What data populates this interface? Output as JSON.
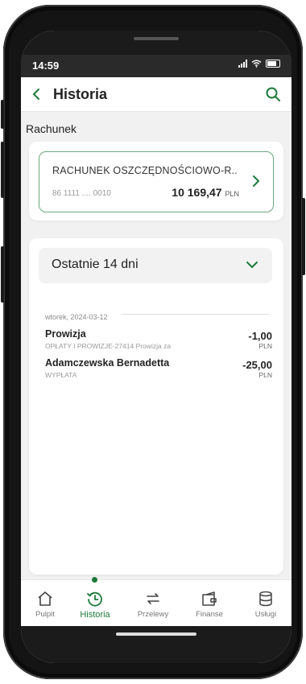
{
  "status": {
    "time": "14:59"
  },
  "header": {
    "title": "Historia"
  },
  "section": {
    "label": "Rachunek"
  },
  "account": {
    "name": "RACHUNEK OSZCZĘDNOŚCIOWO-R..",
    "number": "86 1111 .... 0010",
    "balance": "10 169,47",
    "currency": "PLN"
  },
  "filter": {
    "label": "Ostatnie 14 dni"
  },
  "transactions": {
    "date": "wtorek, 2024-03-12",
    "items": [
      {
        "title": "Prowizja",
        "subtitle": "OPŁATY I PROWIZJE-27414 Prowizja za",
        "amount": "-1,00",
        "currency": "PLN"
      },
      {
        "title": "Adamczewska Bernadetta",
        "subtitle": "WYPŁATA",
        "amount": "-25,00",
        "currency": "PLN"
      }
    ]
  },
  "nav": {
    "items": [
      {
        "label": "Pulpit",
        "icon": "home-icon"
      },
      {
        "label": "Historia",
        "icon": "history-icon"
      },
      {
        "label": "Przelewy",
        "icon": "transfer-icon"
      },
      {
        "label": "Finanse",
        "icon": "wallet-icon"
      },
      {
        "label": "Usługi",
        "icon": "database-icon"
      }
    ]
  },
  "colors": {
    "accent": "#1b7a3a",
    "border_green": "#6aa77f"
  }
}
